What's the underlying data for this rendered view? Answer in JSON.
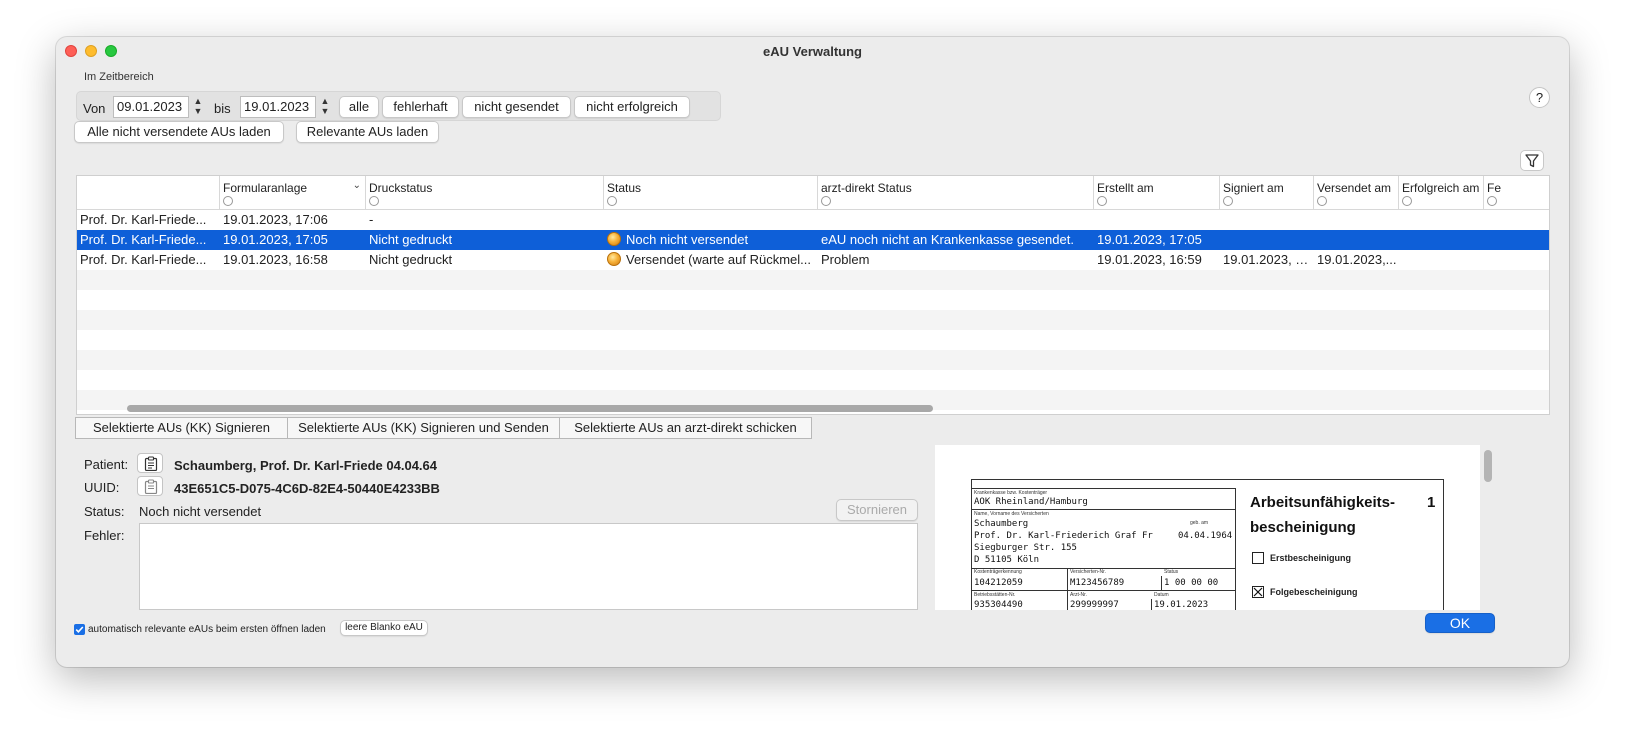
{
  "window": {
    "title": "eAU Verwaltung"
  },
  "filter": {
    "section_label": "Im Zeitbereich",
    "von_label": "Von",
    "von_value": "09.01.2023",
    "bis_label": "bis",
    "bis_value": "19.01.2023",
    "buttons": [
      "alle",
      "fehlerhaft",
      "nicht gesendet",
      "nicht erfolgreich"
    ],
    "help_label": "?"
  },
  "actions": {
    "load_unsent": "Alle nicht versendete AUs laden",
    "load_relevant": "Relevante AUs laden"
  },
  "table": {
    "columns": [
      "",
      "Formularanlage",
      "Druckstatus",
      "Status",
      "arzt-direkt Status",
      "Erstellt am",
      "Signiert am",
      "Versendet am",
      "Erfolgreich am",
      "Fe"
    ],
    "rows": [
      {
        "name": "Prof. Dr. Karl-Friede...",
        "formular": "19.01.2023, 17:06",
        "druck": "-",
        "status": "",
        "arzt": "",
        "erstellt": "",
        "signiert": "",
        "versendet": "",
        "erfolgreich": ""
      },
      {
        "name": "Prof. Dr. Karl-Friede...",
        "formular": "19.01.2023, 17:05",
        "druck": "Nicht gedruckt",
        "status": "Noch nicht versendet",
        "arzt": "eAU noch nicht an Krankenkasse gesendet.",
        "erstellt": "19.01.2023, 17:05",
        "signiert": "",
        "versendet": "",
        "erfolgreich": ""
      },
      {
        "name": "Prof. Dr. Karl-Friede...",
        "formular": "19.01.2023, 16:58",
        "druck": "Nicht gedruckt",
        "status": "Versendet (warte auf Rückmel...",
        "arzt": "Problem",
        "erstellt": "19.01.2023, 16:59",
        "signiert": "19.01.2023, 1...",
        "versendet": "19.01.2023,...",
        "erfolgreich": ""
      }
    ]
  },
  "tabs": [
    "Selektierte AUs (KK) Signieren",
    "Selektierte AUs (KK) Signieren und Senden",
    "Selektierte AUs an arzt-direkt schicken"
  ],
  "details": {
    "patient_label": "Patient:",
    "patient_value": "Schaumberg, Prof. Dr. Karl-Friede 04.04.64",
    "uuid_label": "UUID:",
    "uuid_value": "43E651C5-D075-4C6D-82E4-50440E4233BB",
    "status_label": "Status:",
    "status_value": "Noch nicht versendet",
    "stornieren_label": "Stornieren",
    "fehler_label": "Fehler:"
  },
  "preview": {
    "kasse_label": "Krankenkasse bzw. Kostenträger",
    "kasse_value": "AOK Rheinland/Hamburg",
    "name_label": "Name, Vorname des Versicherten",
    "name_line1": "Schaumberg",
    "geb_label": "geb. am",
    "name_line2": "Prof. Dr. Karl-Friederich Graf Fr",
    "geb_value": "04.04.1964",
    "street": "Siegburger Str. 155",
    "city": "D 51105 Köln",
    "kt_label": "Kostenträgerkennung",
    "kt_value": "104212059",
    "vnr_label": "Versicherten-Nr.",
    "vnr_value": "M123456789",
    "status_label": "Status",
    "status_value": "1 00 00 00",
    "bsnr_label": "Betriebsstätten-Nr.",
    "bsnr_value": "935304490",
    "lanr_label": "Arzt-Nr.",
    "lanr_value": "299999997",
    "datum_label": "Datum",
    "datum_value": "19.01.2023",
    "title_line1": "Arbeitsunfähigkeits-",
    "title_line2": "bescheinigung",
    "copy_no": "1",
    "erst_label": "Erstbescheinigung",
    "folge_label": "Folgebescheinigung"
  },
  "footer": {
    "auto_load_label": "automatisch relevante eAUs beim ersten öffnen laden",
    "auto_load_checked": true,
    "blank_button": "leere Blanko eAU",
    "ok_button": "OK"
  },
  "colors": {
    "selection": "#0e5fd8",
    "ok_button": "#1a6fe5",
    "status_orb": "#f7b23a"
  }
}
